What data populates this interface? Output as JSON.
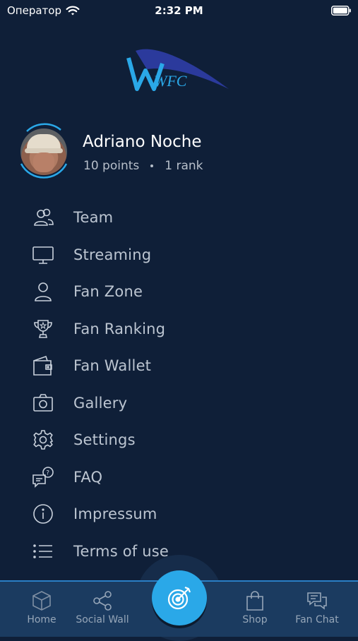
{
  "status_bar": {
    "carrier": "Оператор",
    "time": "2:32 PM"
  },
  "logo": {
    "text": "WFC"
  },
  "profile": {
    "name": "Adriano Noche",
    "points": "10 points",
    "rank": "1 rank"
  },
  "menu": {
    "items": [
      {
        "label": "Team",
        "icon": "team-icon"
      },
      {
        "label": "Streaming",
        "icon": "monitor-icon"
      },
      {
        "label": "Fan Zone",
        "icon": "user-icon"
      },
      {
        "label": "Fan Ranking",
        "icon": "trophy-icon"
      },
      {
        "label": "Fan Wallet",
        "icon": "wallet-icon"
      },
      {
        "label": "Gallery",
        "icon": "camera-icon"
      },
      {
        "label": "Settings",
        "icon": "gear-icon"
      },
      {
        "label": "FAQ",
        "icon": "faq-chat-icon"
      },
      {
        "label": "Impressum",
        "icon": "info-icon"
      },
      {
        "label": "Terms of use",
        "icon": "list-icon"
      }
    ]
  },
  "tab_bar": {
    "tabs": [
      {
        "label": "Home",
        "icon": "home-cube-icon"
      },
      {
        "label": "Social Wall",
        "icon": "share-icon"
      },
      {
        "label": "",
        "icon": "target-icon"
      },
      {
        "label": "Shop",
        "icon": "shopping-bag-icon"
      },
      {
        "label": "Fan Chat",
        "icon": "chat-bubbles-icon"
      }
    ]
  },
  "colors": {
    "background": "#0f1f38",
    "accent": "#2aa8e8",
    "tab_bar": "#1b3b60",
    "text": "#bcc5d1"
  }
}
